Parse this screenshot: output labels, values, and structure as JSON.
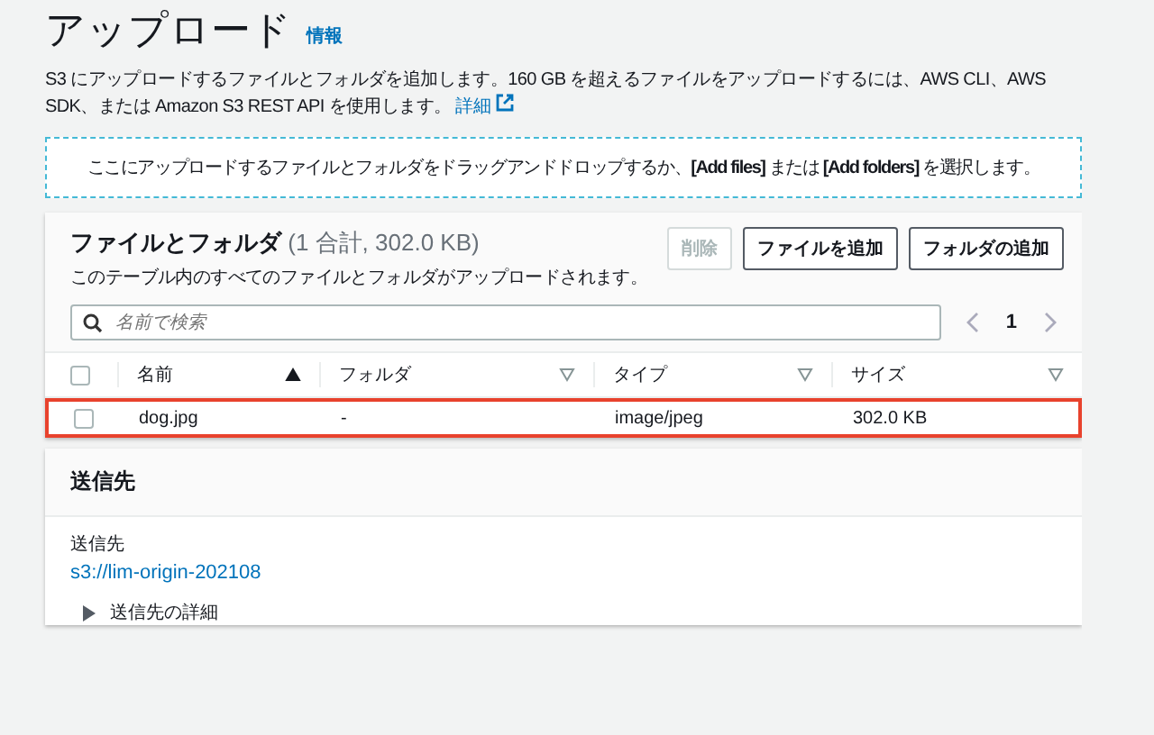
{
  "header": {
    "title": "アップロード",
    "info_link": "情報"
  },
  "description": {
    "text": "S3 にアップロードするファイルとフォルダを追加します。160 GB を超えるファイルをアップロードするには、AWS CLI、AWS SDK、または Amazon S3 REST API を使用します。",
    "link": "詳細"
  },
  "dropzone": {
    "text": "ここにアップロードするファイルとフォルダをドラッグアンドドロップするか、**[Add files]** または **[Add folders]** を選択します。"
  },
  "files_panel": {
    "title": "ファイルとフォルダ",
    "count": "(1 合計, 302.0 KB)",
    "subtitle": "このテーブル内のすべてのファイルとフォルダがアップロードされます。",
    "buttons": [
      {
        "label": "削除",
        "disabled": true
      },
      {
        "label": "ファイルを追加",
        "disabled": false
      },
      {
        "label": "フォルダの追加",
        "disabled": false
      }
    ],
    "search": {
      "placeholder": "名前で検索"
    },
    "pagination": {
      "page": "1"
    },
    "select_all": {
      "checked": false
    },
    "columns": [
      {
        "label": "名前",
        "sorted": true
      },
      {
        "label": "フォルダ",
        "sorted": false
      },
      {
        "label": "タイプ",
        "sorted": false
      },
      {
        "label": "サイズ",
        "sorted": false
      }
    ],
    "rows": [
      {
        "checked": false,
        "highlighted": true,
        "cells": [
          "dog.jpg",
          "-",
          "image/jpeg",
          "302.0 KB"
        ]
      }
    ]
  },
  "destination": {
    "title": "送信先",
    "label": "送信先",
    "value": "s3://lim-origin-202108",
    "details": {
      "label": "送信先の詳細",
      "expanded": false
    }
  }
}
